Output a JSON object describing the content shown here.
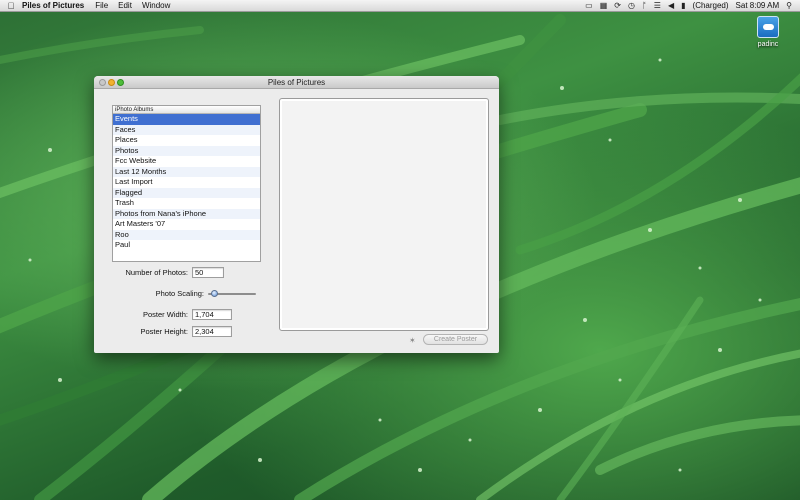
{
  "menubar": {
    "app_name": "Piles of Pictures",
    "menus": [
      "File",
      "Edit",
      "Window"
    ],
    "battery_status": "(Charged)",
    "clock": "Sat 8:09 AM"
  },
  "desktop": {
    "disk_label": "padinc"
  },
  "window": {
    "title": "Piles of Pictures",
    "albums": {
      "header": "iPhoto Albums",
      "items": [
        "Events",
        "Faces",
        "Places",
        "Photos",
        "Fcc Website",
        "Last 12 Months",
        "Last Import",
        "Flagged",
        "Trash",
        "Photos from Nana's iPhone",
        "Art Masters '07",
        "Roo",
        "Paul"
      ],
      "selected_index": 0
    },
    "number_of_photos": {
      "label": "Number of Photos:",
      "value": "50"
    },
    "photo_scaling": {
      "label": "Photo Scaling:",
      "fraction": 0.08
    },
    "poster_width": {
      "label": "Poster Width:",
      "value": "1,704"
    },
    "poster_height": {
      "label": "Poster Height:",
      "value": "2,304"
    },
    "create_poster_label": "Create Poster"
  },
  "colors": {
    "selection": "#3f6fd1",
    "accent": "#5b8fd6"
  }
}
